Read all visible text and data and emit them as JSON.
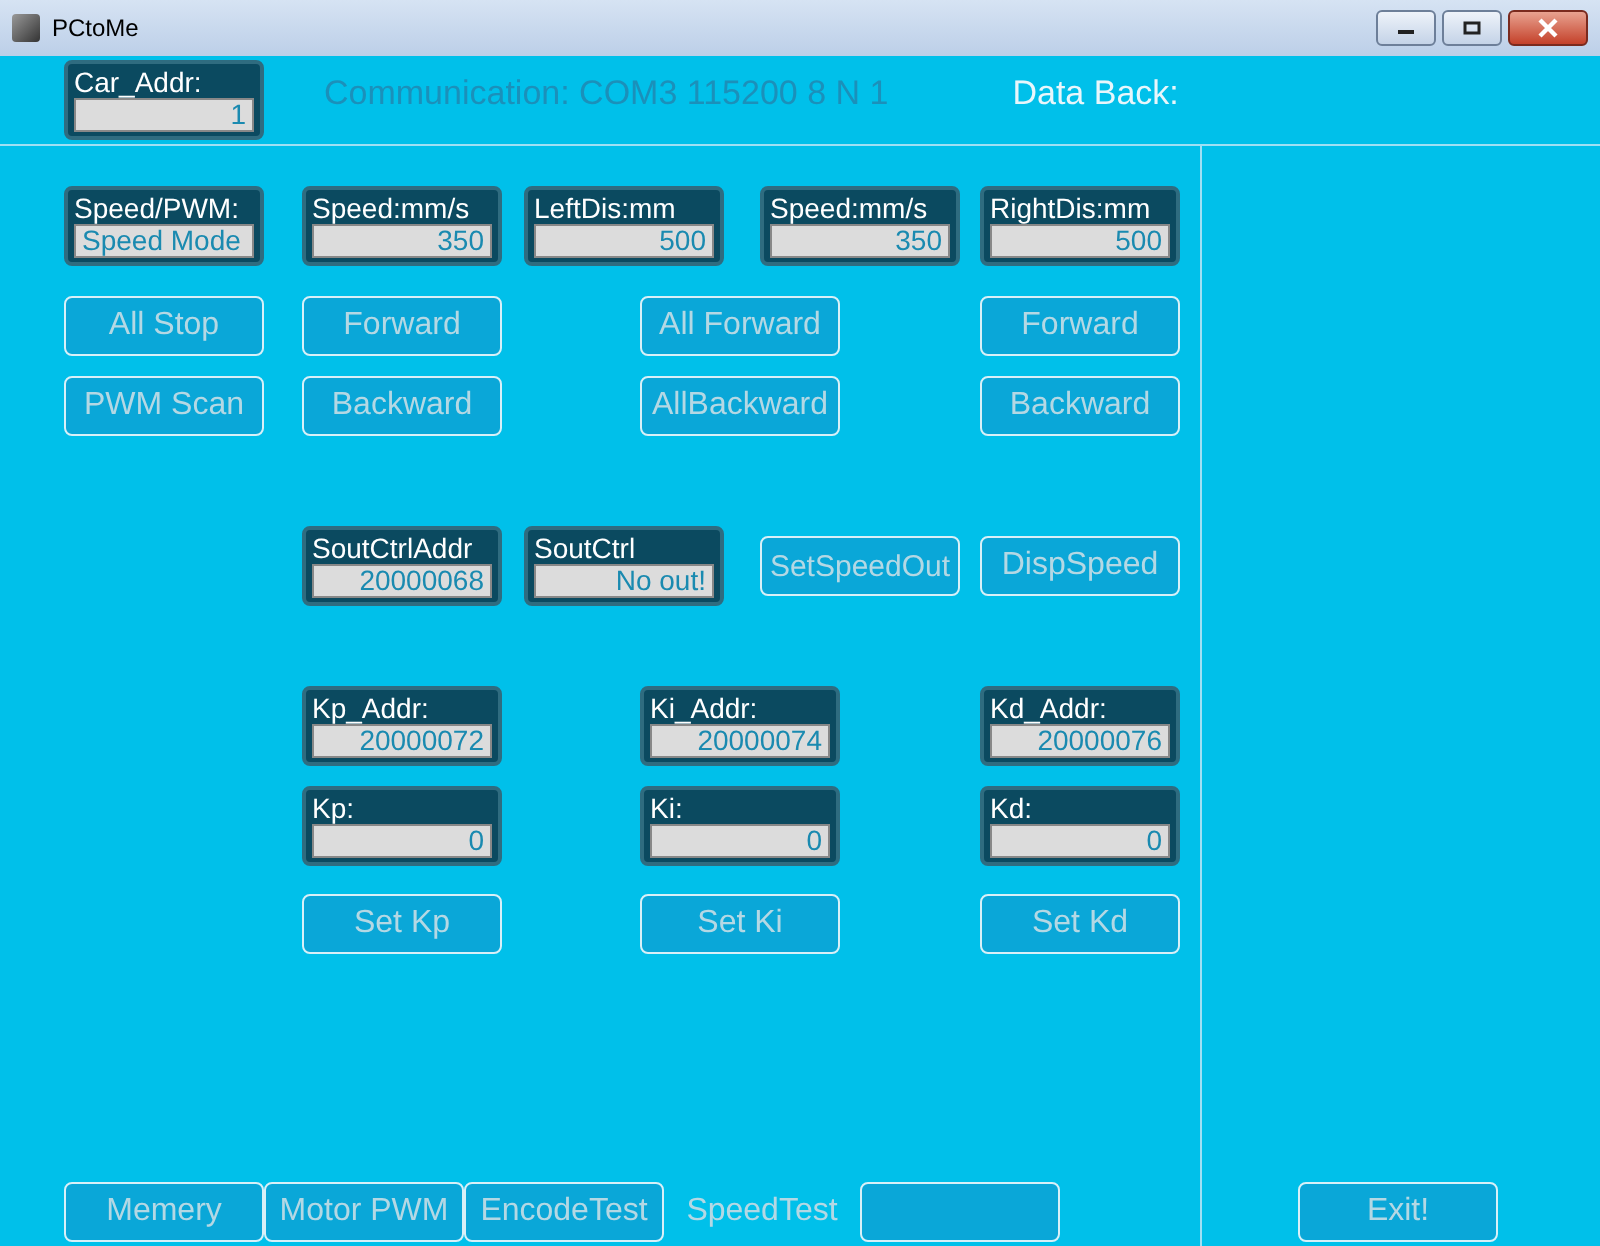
{
  "window": {
    "title": "PCtoMe"
  },
  "header": {
    "car_addr": {
      "label": "Car_Addr:",
      "value": "1"
    },
    "communication": "Communication: COM3 115200 8 N 1",
    "data_back": "Data Back:"
  },
  "fields": [
    {
      "label": "Speed/PWM:",
      "value": "Speed Mode"
    },
    {
      "label": "Speed:mm/s",
      "value": "350"
    },
    {
      "label": "LeftDis:mm",
      "value": "500"
    },
    {
      "label": "Speed:mm/s",
      "value": "350"
    },
    {
      "label": "RightDis:mm",
      "value": "500"
    },
    {
      "label": "SoutCtrlAddr",
      "value": "20000068"
    },
    {
      "label": "SoutCtrl",
      "value": "No out!"
    },
    {
      "label": "Kp_Addr:",
      "value": "20000072"
    },
    {
      "label": "Ki_Addr:",
      "value": "20000074"
    },
    {
      "label": "Kd_Addr:",
      "value": "20000076"
    },
    {
      "label": "Kp:",
      "value": "0"
    },
    {
      "label": "Ki:",
      "value": "0"
    },
    {
      "label": "Kd:",
      "value": "0"
    }
  ],
  "buttons": [
    "All Stop",
    "Forward",
    "All Forward",
    "Forward",
    "PWM Scan",
    "Backward",
    "AllBackward",
    "Backward",
    "SetSpeedOut",
    "DispSpeed",
    "Set Kp",
    "Set Ki",
    "Set Kd"
  ],
  "tabs": [
    {
      "label": "Memery",
      "selected": false
    },
    {
      "label": "Motor PWM",
      "selected": false
    },
    {
      "label": "EncodeTest",
      "selected": false
    },
    {
      "label": "SpeedTest",
      "selected": true
    },
    {
      "selected": false
    }
  ],
  "exit_button": "Exit!"
}
